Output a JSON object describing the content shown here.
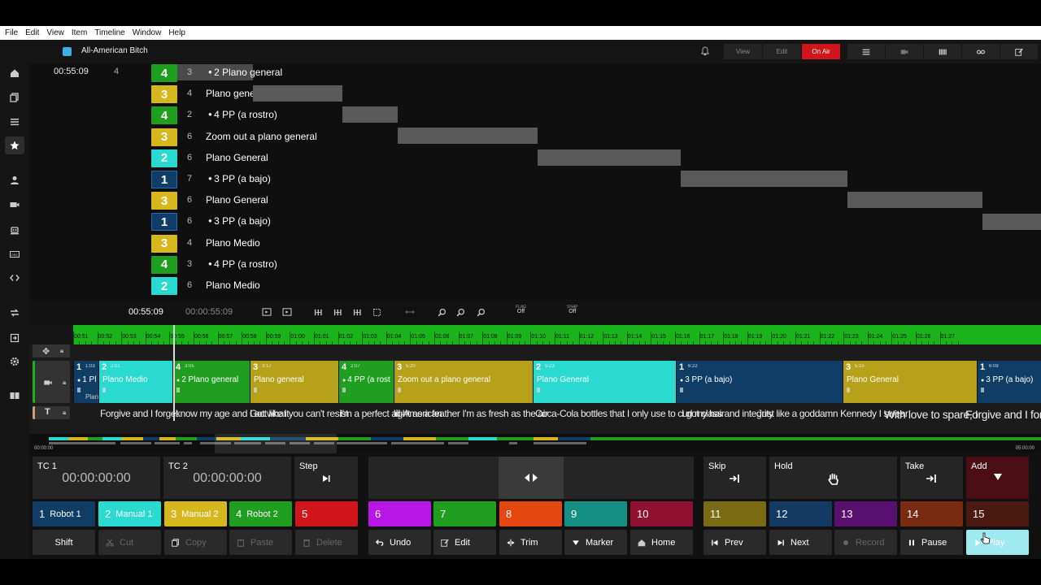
{
  "menu": [
    "File",
    "Edit",
    "View",
    "Item",
    "Timeline",
    "Window",
    "Help"
  ],
  "title": "All-American Bitch",
  "title_color": "#3db0e6",
  "modes": [
    "View",
    "Edit",
    "On Air"
  ],
  "view_icons": [
    "list-icon",
    "camera-icon",
    "columns-icon",
    "tape-icon",
    "edit-icon"
  ],
  "sidebar_icons": [
    "home-icon",
    "copy-icon",
    "list-icon",
    "star-icon",
    "user-icon",
    "video-icon",
    "robot-icon",
    "osc-icon",
    "code-icon",
    "swap-icon",
    "export-icon",
    "settings-icon",
    "book-icon"
  ],
  "shotlist": {
    "current_time": "00:55:09",
    "current_count": "4",
    "rows": [
      {
        "badge": "4",
        "color": "#1f9e1f",
        "num": "3",
        "dot": true,
        "name": "2 Plano general"
      },
      {
        "badge": "3",
        "color": "#d6b71e",
        "num": "4",
        "dot": false,
        "name": "Plano general"
      },
      {
        "badge": "4",
        "color": "#1f9e1f",
        "num": "2",
        "dot": true,
        "name": "4 PP (a rostro)"
      },
      {
        "badge": "3",
        "color": "#d6b71e",
        "num": "6",
        "dot": false,
        "name": "Zoom out a plano general"
      },
      {
        "badge": "2",
        "color": "#2ad9cf",
        "num": "6",
        "dot": false,
        "name": "Plano General"
      },
      {
        "badge": "1",
        "color": "#0f3d66",
        "num": "7",
        "dot": true,
        "name": "3 PP (a bajo)"
      },
      {
        "badge": "3",
        "color": "#d6b71e",
        "num": "6",
        "dot": false,
        "name": "Plano General"
      },
      {
        "badge": "1",
        "color": "#0f3d66",
        "num": "6",
        "dot": true,
        "name": "3 PP (a bajo)"
      },
      {
        "badge": "3",
        "color": "#d6b71e",
        "num": "4",
        "dot": false,
        "name": "Plano Medio"
      },
      {
        "badge": "4",
        "color": "#1f9e1f",
        "num": "3",
        "dot": true,
        "name": "4 PP (a rostro)"
      },
      {
        "badge": "2",
        "color": "#2ad9cf",
        "num": "6",
        "dot": false,
        "name": "Plano Medio"
      }
    ]
  },
  "timeline": {
    "tc_current": "00:55:09",
    "tc_full": "00:00:55:09",
    "flag_label": "FLAG",
    "flag_value": "Off",
    "snap_label": "SNAP",
    "snap_value": "Off",
    "ruler": [
      "00:51",
      "00:52",
      "00:53",
      "00:54",
      "00:55",
      "00:56",
      "00:57",
      "00:58",
      "00:59",
      "01:00",
      "01:01",
      "01:02",
      "01:03",
      "01:04",
      "01:05",
      "01:06",
      "01:07",
      "01:08",
      "01:09",
      "01:10",
      "01:11",
      "01:12",
      "01:13",
      "01:14",
      "01:15",
      "01:16",
      "01:17",
      "01:18",
      "01:19",
      "01:20",
      "01:21",
      "01:22",
      "01:23",
      "01:24",
      "01:25",
      "01:26",
      "01:27"
    ],
    "clips": [
      {
        "num": "1",
        "tc": "1:03",
        "name": "1 Pl",
        "color": "#0f3d66"
      },
      {
        "num": "2",
        "tc": "2:01",
        "name": "Plano Medio",
        "color": "#2ad9cf"
      },
      {
        "num": "4",
        "tc": "3:05",
        "name": "2 Plano general",
        "color": "#1f9e1f"
      },
      {
        "num": "3",
        "tc": "3:17",
        "name": "Plano general",
        "color": "#b8a11a"
      },
      {
        "num": "4",
        "tc": "2:07",
        "name": "4 PP (a rost",
        "color": "#1f9e1f"
      },
      {
        "num": "3",
        "tc": "5:20",
        "name": "Zoom out a plano general",
        "color": "#b8a11a"
      },
      {
        "num": "2",
        "tc": "5:23",
        "name": "Plano General",
        "color": "#2ad9cf"
      },
      {
        "num": "1",
        "tc": "6:22",
        "name": "3 PP (a bajo)",
        "color": "#0f3d66"
      },
      {
        "num": "3",
        "tc": "5:15",
        "name": "Plano General",
        "color": "#b8a11a"
      },
      {
        "num": "1",
        "tc": "6:09",
        "name": "3 PP (a bajo)",
        "color": "#0f3d66"
      }
    ],
    "clip_extra_label": "Plan",
    "subtitles": [
      "Forgive and I forget",
      "know my age and I act like it",
      "Got what you can't resist",
      "I'm a perfect all-American",
      "light as a feather I'm as fresh as the air",
      "Coca-Cola bottles that I only use to curl my hair",
      "I got class and integrity",
      "Just like a goddamn Kennedy I swear",
      "With love to spare, I",
      "Forgive and I forg"
    ],
    "overview_start": "00:00:00",
    "overview_end": "05:00:00"
  },
  "controls": {
    "tc1_label": "TC 1",
    "tc1_value": "00:00:00:00",
    "tc2_label": "TC 2",
    "tc2_value": "00:00:00:00",
    "step_label": "Step",
    "skip_label": "Skip",
    "hold_label": "Hold",
    "take_label": "Take",
    "add_label": "Add",
    "presets": [
      {
        "num": "1",
        "name": "Robot 1",
        "color": "#0f3d66",
        "fg": "#fff"
      },
      {
        "num": "2",
        "name": "Manual 1",
        "color": "#2ad9cf",
        "fg": "#fff"
      },
      {
        "num": "3",
        "name": "Manual 2",
        "color": "#d6b71e",
        "fg": "#fff"
      },
      {
        "num": "4",
        "name": "Robot 2",
        "color": "#1f9e1f",
        "fg": "#fff"
      },
      {
        "num": "5",
        "name": "",
        "color": "#d0161a",
        "fg": "#fff"
      },
      {
        "num": "6",
        "name": "",
        "color": "#b816e6",
        "fg": "#fff"
      },
      {
        "num": "7",
        "name": "",
        "color": "#1f9e1f",
        "fg": "#fff"
      },
      {
        "num": "8",
        "name": "",
        "color": "#e4470f",
        "fg": "#fff"
      },
      {
        "num": "9",
        "name": "",
        "color": "#168f84",
        "fg": "#fff"
      },
      {
        "num": "10",
        "name": "",
        "color": "#8f1030",
        "fg": "#fff"
      },
      {
        "num": "11",
        "name": "",
        "color": "#7a6a12",
        "fg": "#fff"
      },
      {
        "num": "12",
        "name": "",
        "color": "#123a63",
        "fg": "#fff"
      },
      {
        "num": "13",
        "name": "",
        "color": "#5a1070",
        "fg": "#fff"
      },
      {
        "num": "14",
        "name": "",
        "color": "#7a2a10",
        "fg": "#fff"
      },
      {
        "num": "15",
        "name": "",
        "color": "#4a1a10",
        "fg": "#fff"
      }
    ],
    "actions": [
      {
        "label": "Shift",
        "icon": "",
        "enabled": true,
        "name": "shift-button"
      },
      {
        "label": "Cut",
        "icon": "scissors-icon",
        "enabled": false,
        "name": "cut-button"
      },
      {
        "label": "Copy",
        "icon": "copy-icon",
        "enabled": false,
        "name": "copy-button"
      },
      {
        "label": "Paste",
        "icon": "paste-icon",
        "enabled": false,
        "name": "paste-button"
      },
      {
        "label": "Delete",
        "icon": "trash-icon",
        "enabled": false,
        "name": "delete-button"
      },
      {
        "label": "Undo",
        "icon": "undo-icon",
        "enabled": true,
        "name": "undo-button"
      },
      {
        "label": "Edit",
        "icon": "edit-icon",
        "enabled": true,
        "name": "edit-button"
      },
      {
        "label": "Trim",
        "icon": "trim-icon",
        "enabled": true,
        "name": "trim-button"
      },
      {
        "label": "Marker",
        "icon": "marker-icon",
        "enabled": true,
        "name": "marker-button"
      },
      {
        "label": "Home",
        "icon": "home-icon",
        "enabled": true,
        "name": "home-button"
      },
      {
        "label": "Prev",
        "icon": "prev-icon",
        "enabled": true,
        "name": "prev-button"
      },
      {
        "label": "Next",
        "icon": "next-icon",
        "enabled": true,
        "name": "next-button"
      },
      {
        "label": "Record",
        "icon": "record-icon",
        "enabled": false,
        "name": "record-button"
      },
      {
        "label": "Pause",
        "icon": "pause-icon",
        "enabled": true,
        "name": "pause-button"
      },
      {
        "label": "Play",
        "icon": "play-icon",
        "enabled": true,
        "name": "play-button"
      }
    ]
  }
}
